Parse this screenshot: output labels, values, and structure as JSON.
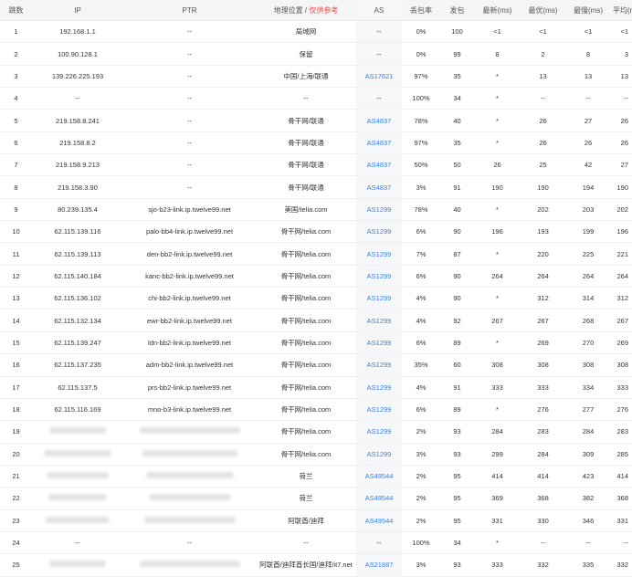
{
  "headers": {
    "hop": "跳数",
    "ip": "IP",
    "ptr": "PTR",
    "geo": "地理位置 /",
    "geo_note": "仅供参考",
    "as": "AS",
    "loss": "丢包率",
    "sent": "发包",
    "last": "最新(ms)",
    "best": "最优(ms)",
    "worst": "最慢(ms)",
    "avg": "平均(ms)"
  },
  "rows": [
    {
      "hop": "1",
      "ip": "192.168.1.1",
      "ptr": "--",
      "geo": "局域网",
      "as": "--",
      "loss": "0%",
      "sent": "100",
      "last": "<1",
      "best": "<1",
      "worst": "<1",
      "avg": "<1"
    },
    {
      "hop": "2",
      "ip": "100.90.128.1",
      "ptr": "--",
      "geo": "保留",
      "as": "--",
      "loss": "0%",
      "sent": "99",
      "last": "8",
      "best": "2",
      "worst": "8",
      "avg": "3"
    },
    {
      "hop": "3",
      "ip": "139.226.225.193",
      "ptr": "--",
      "geo": "中国/上海/联通",
      "as": "AS17621",
      "loss": "97%",
      "sent": "35",
      "last": "*",
      "best": "13",
      "worst": "13",
      "avg": "13"
    },
    {
      "hop": "4",
      "ip": "--",
      "ptr": "--",
      "geo": "--",
      "as": "--",
      "loss": "100%",
      "sent": "34",
      "last": "*",
      "best": "--",
      "worst": "--",
      "avg": "--"
    },
    {
      "hop": "5",
      "ip": "219.158.8.241",
      "ptr": "--",
      "geo": "骨干网/联通",
      "as": "AS4837",
      "loss": "78%",
      "sent": "40",
      "last": "*",
      "best": "26",
      "worst": "27",
      "avg": "26"
    },
    {
      "hop": "6",
      "ip": "219.158.8.2",
      "ptr": "--",
      "geo": "骨干网/联通",
      "as": "AS4837",
      "loss": "97%",
      "sent": "35",
      "last": "*",
      "best": "26",
      "worst": "26",
      "avg": "26"
    },
    {
      "hop": "7",
      "ip": "219.158.9.213",
      "ptr": "--",
      "geo": "骨干网/联通",
      "as": "AS4837",
      "loss": "50%",
      "sent": "50",
      "last": "26",
      "best": "25",
      "worst": "42",
      "avg": "27"
    },
    {
      "hop": "8",
      "ip": "219.158.3.90",
      "ptr": "--",
      "geo": "骨干网/联通",
      "as": "AS4837",
      "loss": "3%",
      "sent": "91",
      "last": "190",
      "best": "190",
      "worst": "194",
      "avg": "190"
    },
    {
      "hop": "9",
      "ip": "80.239.135.4",
      "ptr": "sjo-b23-link.ip.twelve99.net",
      "geo": "美国/telia.com",
      "as": "AS1299",
      "loss": "78%",
      "sent": "40",
      "last": "*",
      "best": "202",
      "worst": "203",
      "avg": "202"
    },
    {
      "hop": "10",
      "ip": "62.115.139.116",
      "ptr": "palo-bb4-link.ip.twelve99.net",
      "geo": "骨干网/telia.com",
      "as": "AS1299",
      "loss": "6%",
      "sent": "90",
      "last": "196",
      "best": "193",
      "worst": "199",
      "avg": "196"
    },
    {
      "hop": "11",
      "ip": "62.115.139.113",
      "ptr": "den-bb2-link.ip.twelve99.net",
      "geo": "骨干网/telia.com",
      "as": "AS1299",
      "loss": "7%",
      "sent": "87",
      "last": "*",
      "best": "220",
      "worst": "225",
      "avg": "221"
    },
    {
      "hop": "12",
      "ip": "62.115.140.184",
      "ptr": "kanc-bb2-link.ip.twelve99.net",
      "geo": "骨干网/telia.com",
      "as": "AS1299",
      "loss": "6%",
      "sent": "90",
      "last": "264",
      "best": "264",
      "worst": "264",
      "avg": "264"
    },
    {
      "hop": "13",
      "ip": "62.115.136.102",
      "ptr": "chi-bb2-link.ip.twelve99.net",
      "geo": "骨干网/telia.com",
      "as": "AS1299",
      "loss": "4%",
      "sent": "90",
      "last": "*",
      "best": "312",
      "worst": "314",
      "avg": "312"
    },
    {
      "hop": "14",
      "ip": "62.115.132.134",
      "ptr": "ewr-bb2-link.ip.twelve99.net",
      "geo": "骨干网/telia.com",
      "as": "AS1299",
      "loss": "4%",
      "sent": "92",
      "last": "267",
      "best": "267",
      "worst": "268",
      "avg": "267"
    },
    {
      "hop": "15",
      "ip": "62.115.139.247",
      "ptr": "ldn-bb2-link.ip.twelve99.net",
      "geo": "骨干网/telia.com",
      "as": "AS1299",
      "loss": "6%",
      "sent": "89",
      "last": "*",
      "best": "269",
      "worst": "270",
      "avg": "269"
    },
    {
      "hop": "16",
      "ip": "62.115.137.235",
      "ptr": "adm-bb2-link.ip.twelve99.net",
      "geo": "骨干网/telia.com",
      "as": "AS1299",
      "loss": "35%",
      "sent": "60",
      "last": "308",
      "best": "308",
      "worst": "308",
      "avg": "308"
    },
    {
      "hop": "17",
      "ip": "62.115.137.5",
      "ptr": "prs-bb2-link.ip.twelve99.net",
      "geo": "骨干网/telia.com",
      "as": "AS1299",
      "loss": "4%",
      "sent": "91",
      "last": "333",
      "best": "333",
      "worst": "334",
      "avg": "333"
    },
    {
      "hop": "18",
      "ip": "62.115.116.169",
      "ptr": "mno-b3-link.ip.twelve99.net",
      "geo": "骨干网/telia.com",
      "as": "AS1299",
      "loss": "6%",
      "sent": "89",
      "last": "*",
      "best": "276",
      "worst": "277",
      "avg": "276"
    },
    {
      "hop": "19",
      "ip": "",
      "ptr": "",
      "geo": "骨干网/telia.com",
      "as": "AS1299",
      "loss": "2%",
      "sent": "93",
      "last": "284",
      "best": "283",
      "worst": "284",
      "avg": "283"
    },
    {
      "hop": "20",
      "ip": "",
      "ptr": "",
      "geo": "骨干网/telia.com",
      "as": "AS1299",
      "loss": "3%",
      "sent": "93",
      "last": "299",
      "best": "284",
      "worst": "309",
      "avg": "285"
    },
    {
      "hop": "21",
      "ip": "",
      "ptr": "",
      "geo": "荷兰",
      "as": "AS49544",
      "loss": "2%",
      "sent": "95",
      "last": "414",
      "best": "414",
      "worst": "423",
      "avg": "414"
    },
    {
      "hop": "22",
      "ip": "",
      "ptr": "",
      "geo": "荷兰",
      "as": "AS49544",
      "loss": "2%",
      "sent": "95",
      "last": "369",
      "best": "368",
      "worst": "382",
      "avg": "368"
    },
    {
      "hop": "23",
      "ip": "",
      "ptr": "",
      "geo": "阿联酋/迪拜",
      "as": "AS49544",
      "loss": "2%",
      "sent": "95",
      "last": "331",
      "best": "330",
      "worst": "346",
      "avg": "331"
    },
    {
      "hop": "24",
      "ip": "--",
      "ptr": "--",
      "geo": "--",
      "as": "--",
      "loss": "100%",
      "sent": "34",
      "last": "*",
      "best": "--",
      "worst": "--",
      "avg": "--"
    },
    {
      "hop": "25",
      "ip": "",
      "ptr": "",
      "geo": "阿联酋/迪拜酋长国/迪拜/it7.net",
      "as": "AS21887",
      "loss": "3%",
      "sent": "93",
      "last": "333",
      "best": "332",
      "worst": "335",
      "avg": "332"
    }
  ]
}
